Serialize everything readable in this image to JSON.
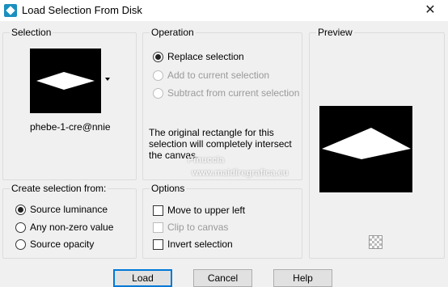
{
  "window": {
    "title": "Load Selection From Disk",
    "close_glyph": "✕"
  },
  "selection": {
    "title": "Selection",
    "name": "phebe-1-cre@nnie"
  },
  "operation": {
    "title": "Operation",
    "options": [
      {
        "label": "Replace selection",
        "checked": true,
        "enabled": true
      },
      {
        "label": "Add to current selection",
        "checked": false,
        "enabled": false
      },
      {
        "label": "Subtract from current selection",
        "checked": false,
        "enabled": false
      }
    ],
    "description": "The original rectangle for this selection will completely intersect the canvas."
  },
  "preview": {
    "title": "Preview"
  },
  "create_from": {
    "title": "Create selection from:",
    "options": [
      {
        "label": "Source luminance",
        "checked": true
      },
      {
        "label": "Any non-zero value",
        "checked": false
      },
      {
        "label": "Source opacity",
        "checked": false
      }
    ]
  },
  "options": {
    "title": "Options",
    "items": [
      {
        "label": "Move to upper left",
        "checked": false,
        "enabled": true
      },
      {
        "label": "Clip to canvas",
        "checked": false,
        "enabled": false
      },
      {
        "label": "Invert selection",
        "checked": false,
        "enabled": true
      }
    ]
  },
  "buttons": {
    "load": "Load",
    "cancel": "Cancel",
    "help": "Help"
  },
  "watermark": {
    "line1": "Pinuccia",
    "line2": "www.maidiregrafica.eu"
  },
  "icons": {
    "app": "paint-shop-app-icon",
    "close": "close-icon",
    "dropdown": "dropdown-arrow-icon",
    "checker": "transparency-checker-icon"
  }
}
